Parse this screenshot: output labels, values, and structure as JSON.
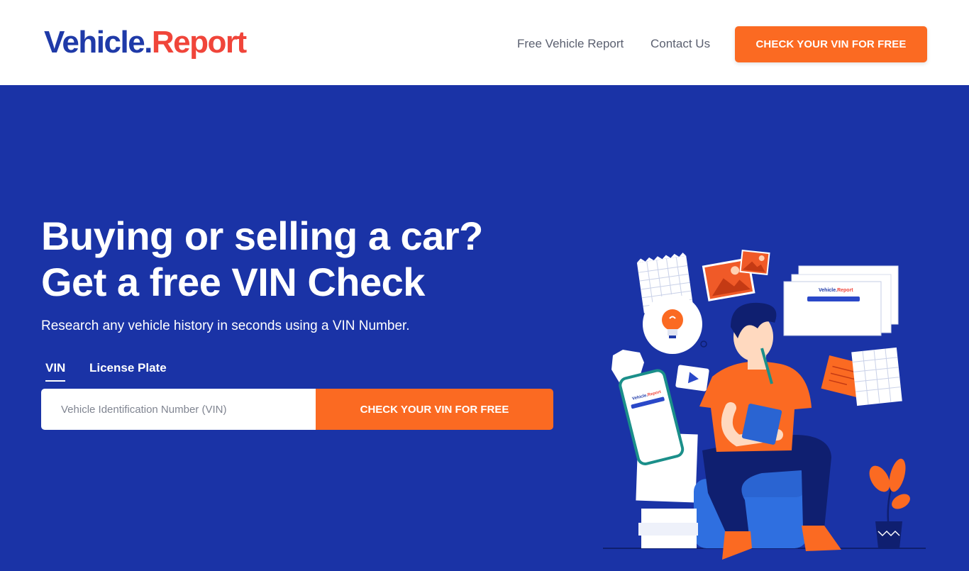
{
  "header": {
    "logo": {
      "part1": "Vehicle.",
      "part2": "Report"
    },
    "nav": [
      {
        "label": "Free Vehicle Report"
      },
      {
        "label": "Contact Us"
      }
    ],
    "cta_label": "CHECK YOUR VIN FOR FREE"
  },
  "hero": {
    "headline_line1": "Buying or selling a car?",
    "headline_line2": "Get a free VIN Check",
    "subtext": "Research any vehicle history in seconds using a VIN Number.",
    "tabs": [
      {
        "label": "VIN",
        "active": true
      },
      {
        "label": "License Plate",
        "active": false
      }
    ],
    "search": {
      "value": "",
      "placeholder": "Vehicle Identification Number (VIN)",
      "button_label": "CHECK YOUR VIN FOR FREE"
    }
  },
  "illustration": {
    "doc_logo": {
      "part1": "Vehicle.",
      "part2": "Report"
    },
    "phone_logo": {
      "part1": "Vehicle.",
      "part2": "Report"
    }
  },
  "colors": {
    "brand_blue": "#1f3aa8",
    "brand_red": "#f0453a",
    "hero_background": "#1a33a6",
    "accent_orange": "#fb6a22",
    "header_background": "#ffffff"
  },
  "icons": [
    "lightbulb-icon",
    "play-icon",
    "image-icon",
    "plant-icon"
  ]
}
